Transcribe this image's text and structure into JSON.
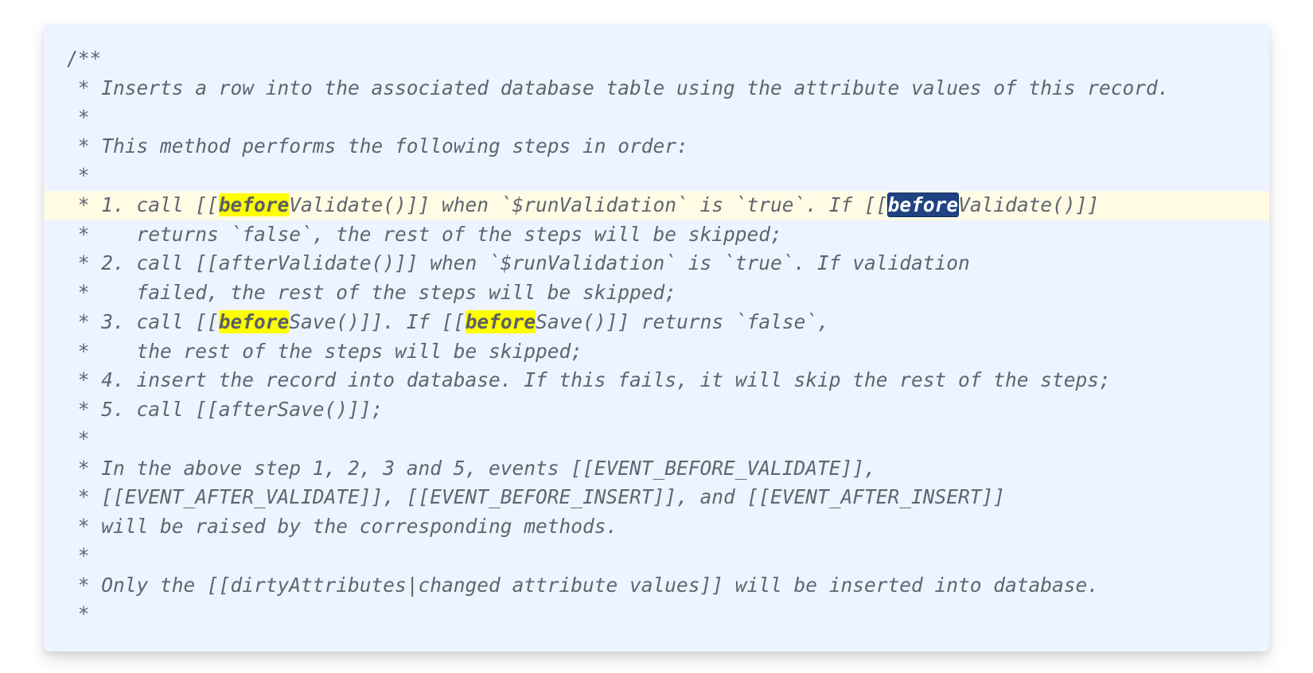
{
  "search_term": "before",
  "highlighted_line_index": 5,
  "lines": [
    {
      "segments": [
        {
          "t": "/**",
          "cls": "plain"
        }
      ]
    },
    {
      "segments": [
        {
          "t": " * ",
          "cls": "plain"
        },
        {
          "t": "Inserts a row into the associated database table using the attribute values of this record."
        }
      ]
    },
    {
      "segments": [
        {
          "t": " *",
          "cls": "plain"
        }
      ]
    },
    {
      "segments": [
        {
          "t": " * ",
          "cls": "plain"
        },
        {
          "t": "This method performs the following steps in order:"
        }
      ]
    },
    {
      "segments": [
        {
          "t": " *",
          "cls": "plain"
        }
      ]
    },
    {
      "segments": [
        {
          "t": " * ",
          "cls": "plain"
        },
        {
          "t": "1. call [["
        },
        {
          "t": "before",
          "cls": "hl"
        },
        {
          "t": "Validate()]] when `$runValidation` is `true`. If [["
        },
        {
          "t": "before",
          "cls": "sel"
        },
        {
          "t": "Validate()]]"
        }
      ]
    },
    {
      "segments": [
        {
          "t": " *    ",
          "cls": "plain"
        },
        {
          "t": "returns `false`, the rest of the steps will be skipped;"
        }
      ]
    },
    {
      "segments": [
        {
          "t": " * ",
          "cls": "plain"
        },
        {
          "t": "2. call [[afterValidate()]] when `$runValidation` is `true`. If validation"
        }
      ]
    },
    {
      "segments": [
        {
          "t": " *    ",
          "cls": "plain"
        },
        {
          "t": "failed, the rest of the steps will be skipped;"
        }
      ]
    },
    {
      "segments": [
        {
          "t": " * ",
          "cls": "plain"
        },
        {
          "t": "3. call [["
        },
        {
          "t": "before",
          "cls": "hl"
        },
        {
          "t": "Save()]]. If [["
        },
        {
          "t": "before",
          "cls": "hl"
        },
        {
          "t": "Save()]] returns `false`,"
        }
      ]
    },
    {
      "segments": [
        {
          "t": " *    ",
          "cls": "plain"
        },
        {
          "t": "the rest of the steps will be skipped;"
        }
      ]
    },
    {
      "segments": [
        {
          "t": " * ",
          "cls": "plain"
        },
        {
          "t": "4. insert the record into database. If this fails, it will skip the rest of the steps;"
        }
      ]
    },
    {
      "segments": [
        {
          "t": " * ",
          "cls": "plain"
        },
        {
          "t": "5. call [[afterSave()]];"
        }
      ]
    },
    {
      "segments": [
        {
          "t": " *",
          "cls": "plain"
        }
      ]
    },
    {
      "segments": [
        {
          "t": " * ",
          "cls": "plain"
        },
        {
          "t": "In the above step 1, 2, 3 and 5, events [[EVENT_BEFORE_VALIDATE]],"
        }
      ]
    },
    {
      "segments": [
        {
          "t": " * ",
          "cls": "plain"
        },
        {
          "t": "[[EVENT_AFTER_VALIDATE]], [[EVENT_BEFORE_INSERT]], and [[EVENT_AFTER_INSERT]]"
        }
      ]
    },
    {
      "segments": [
        {
          "t": " * ",
          "cls": "plain"
        },
        {
          "t": "will be raised by the corresponding methods."
        }
      ]
    },
    {
      "segments": [
        {
          "t": " *",
          "cls": "plain"
        }
      ]
    },
    {
      "segments": [
        {
          "t": " * ",
          "cls": "plain"
        },
        {
          "t": "Only the [[dirtyAttributes|changed attribute values]] will be inserted into database."
        }
      ]
    },
    {
      "segments": [
        {
          "t": " *",
          "cls": "plain"
        }
      ]
    }
  ]
}
